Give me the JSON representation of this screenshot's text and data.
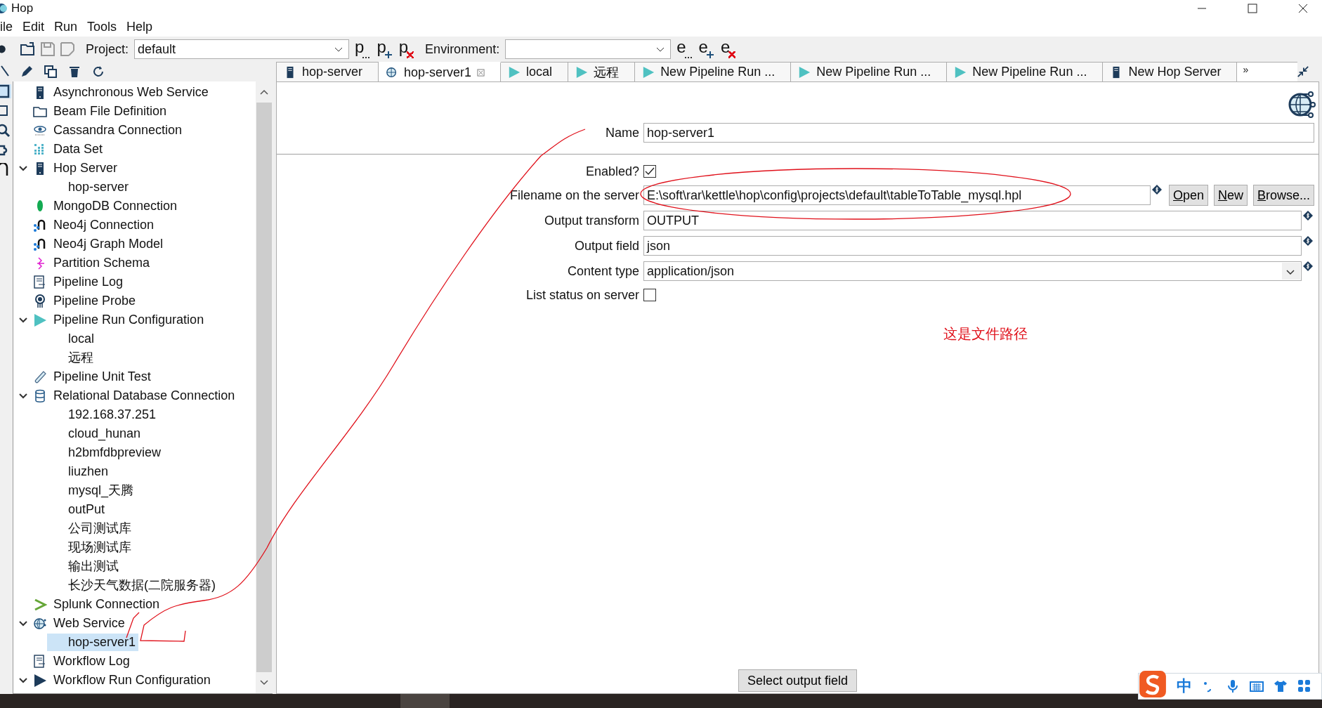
{
  "window": {
    "title": "Hop"
  },
  "menu": [
    "ile",
    "Edit",
    "Run",
    "Tools",
    "Help"
  ],
  "toolbar": {
    "project_label": "Project:",
    "project": "default",
    "environment_label": "Environment:",
    "project_actions": [
      {
        "letter": "p",
        "kind": "edit"
      },
      {
        "letter": "p",
        "kind": "add"
      },
      {
        "letter": "p",
        "kind": "delete"
      }
    ],
    "environment_actions": [
      {
        "letter": "e",
        "kind": "edit"
      },
      {
        "letter": "e",
        "kind": "add"
      },
      {
        "letter": "e",
        "kind": "delete"
      }
    ]
  },
  "tabs": [
    {
      "label": "hop-server",
      "kind": "server",
      "selected": false
    },
    {
      "label": "hop-server1",
      "kind": "webservice",
      "selected": true
    },
    {
      "label": "local",
      "kind": "runconfig",
      "selected": false
    },
    {
      "label": "远程",
      "kind": "runconfig",
      "selected": false
    },
    {
      "label": "New Pipeline Run ...",
      "kind": "runconfig",
      "selected": false
    },
    {
      "label": "New Pipeline Run ...",
      "kind": "runconfig",
      "selected": false
    },
    {
      "label": "New Pipeline Run ...",
      "kind": "runconfig",
      "selected": false
    },
    {
      "label": "New Hop Server",
      "kind": "server",
      "selected": false
    }
  ],
  "tabs_overflow": "»",
  "tree": [
    {
      "label": "Asynchronous Web Service",
      "kind": "server",
      "selected": false
    },
    {
      "label": "Beam File Definition",
      "kind": "folder",
      "selected": false
    },
    {
      "label": "Cassandra Connection",
      "kind": "eye",
      "selected": false
    },
    {
      "label": "Data Set",
      "kind": "dataset",
      "selected": false
    },
    {
      "label": "Hop Server",
      "kind": "server",
      "selected": false,
      "expanded": true,
      "children": [
        {
          "label": "hop-server",
          "selected": false
        }
      ]
    },
    {
      "label": "MongoDB Connection",
      "kind": "leaf",
      "selected": false
    },
    {
      "label": "Neo4j Connection",
      "kind": "neo4j",
      "selected": false
    },
    {
      "label": "Neo4j Graph Model",
      "kind": "neo4j",
      "selected": false
    },
    {
      "label": "Partition Schema",
      "kind": "partition",
      "selected": false
    },
    {
      "label": "Pipeline Log",
      "kind": "log",
      "selected": false
    },
    {
      "label": "Pipeline Probe",
      "kind": "probe",
      "selected": false
    },
    {
      "label": "Pipeline Run Configuration",
      "kind": "play",
      "selected": false,
      "expanded": true,
      "children": [
        {
          "label": "local",
          "selected": false
        },
        {
          "label": "远程",
          "selected": false
        }
      ]
    },
    {
      "label": "Pipeline Unit Test",
      "kind": "testtube",
      "selected": false
    },
    {
      "label": "Relational Database Connection",
      "kind": "database",
      "selected": false,
      "expanded": true,
      "children": [
        {
          "label": "192.168.37.251",
          "selected": false
        },
        {
          "label": "cloud_hunan",
          "selected": false
        },
        {
          "label": "h2bmfdbpreview",
          "selected": false
        },
        {
          "label": "liuzhen",
          "selected": false
        },
        {
          "label": "mysql_天腾",
          "selected": false
        },
        {
          "label": "outPut",
          "selected": false
        },
        {
          "label": "公司测试库",
          "selected": false
        },
        {
          "label": "现场测试库",
          "selected": false
        },
        {
          "label": "输出测试",
          "selected": false
        },
        {
          "label": "长沙天气数据(二院服务器)",
          "selected": false
        }
      ]
    },
    {
      "label": "Splunk Connection",
      "kind": "splunk",
      "selected": false
    },
    {
      "label": "Web Service",
      "kind": "globe",
      "selected": false,
      "expanded": true,
      "children": [
        {
          "label": "hop-server1",
          "selected": true
        }
      ]
    },
    {
      "label": "Workflow Log",
      "kind": "log",
      "selected": false
    },
    {
      "label": "Workflow Run Configuration",
      "kind": "playdark",
      "selected": false,
      "expanded": true
    }
  ],
  "form": [
    {
      "kind": "text",
      "label": "Name",
      "value": "hop-server1"
    },
    {
      "kind": "separator"
    },
    {
      "kind": "checkbox",
      "label": "Enabled?",
      "checked": true
    },
    {
      "kind": "file",
      "label": "Filename on the server",
      "value": "E:\\soft\\rar\\kettle\\hop\\config\\projects\\default\\tableToTable_mysql.hpl",
      "variable": true,
      "buttons": [
        "Open",
        "New",
        "Browse..."
      ]
    },
    {
      "kind": "text",
      "label": "Output transform",
      "value": "OUTPUT",
      "variable": true
    },
    {
      "kind": "text",
      "label": "Output field",
      "value": "json",
      "variable": true
    },
    {
      "kind": "select",
      "label": "Content type",
      "value": "application/json",
      "variable": true
    },
    {
      "kind": "checkbox",
      "label": "List status on server",
      "checked": false
    }
  ],
  "annotation_note": "这是文件路径",
  "bottom_button": "Select output field",
  "ime": {
    "mode": "中"
  }
}
